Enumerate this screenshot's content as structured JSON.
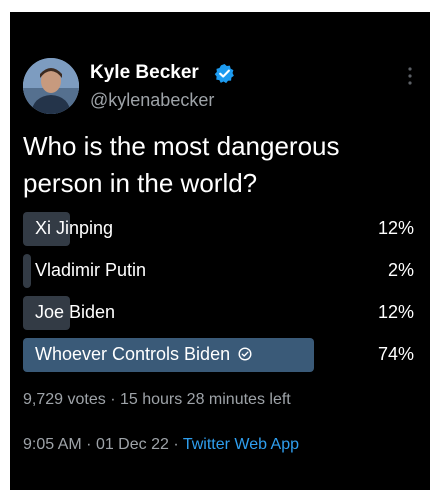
{
  "tweet": {
    "author_name": "Kyle Becker",
    "author_handle": "@kylenabecker",
    "question_line1": "Who is the most dangerous",
    "question_line2": "person in the world?"
  },
  "poll": {
    "options": [
      {
        "label": "Xi Jinping",
        "percent": "12%",
        "share": 12
      },
      {
        "label": "Vladimir Putin",
        "percent": "2%",
        "share": 2
      },
      {
        "label": "Joe Biden",
        "percent": "12%",
        "share": 12
      },
      {
        "label": "Whoever Controls Biden",
        "percent": "74%",
        "share": 74
      }
    ],
    "votes": "9,729 votes",
    "separator": "·",
    "time_left": "15 hours 28 minutes left"
  },
  "footer": {
    "time": "9:05 AM",
    "separator": "·",
    "date": "01 Dec 22",
    "app": "Twitter Web App"
  },
  "icons": {
    "verified": "verified-badge-icon",
    "more": "more-options-icon",
    "winner_check": "check-circle-icon"
  },
  "colors": {
    "background": "#000000",
    "bar": "#333b45",
    "winning_bar": "#3a5a78",
    "link": "#2f9fef",
    "verified": "#1d9bf0"
  }
}
